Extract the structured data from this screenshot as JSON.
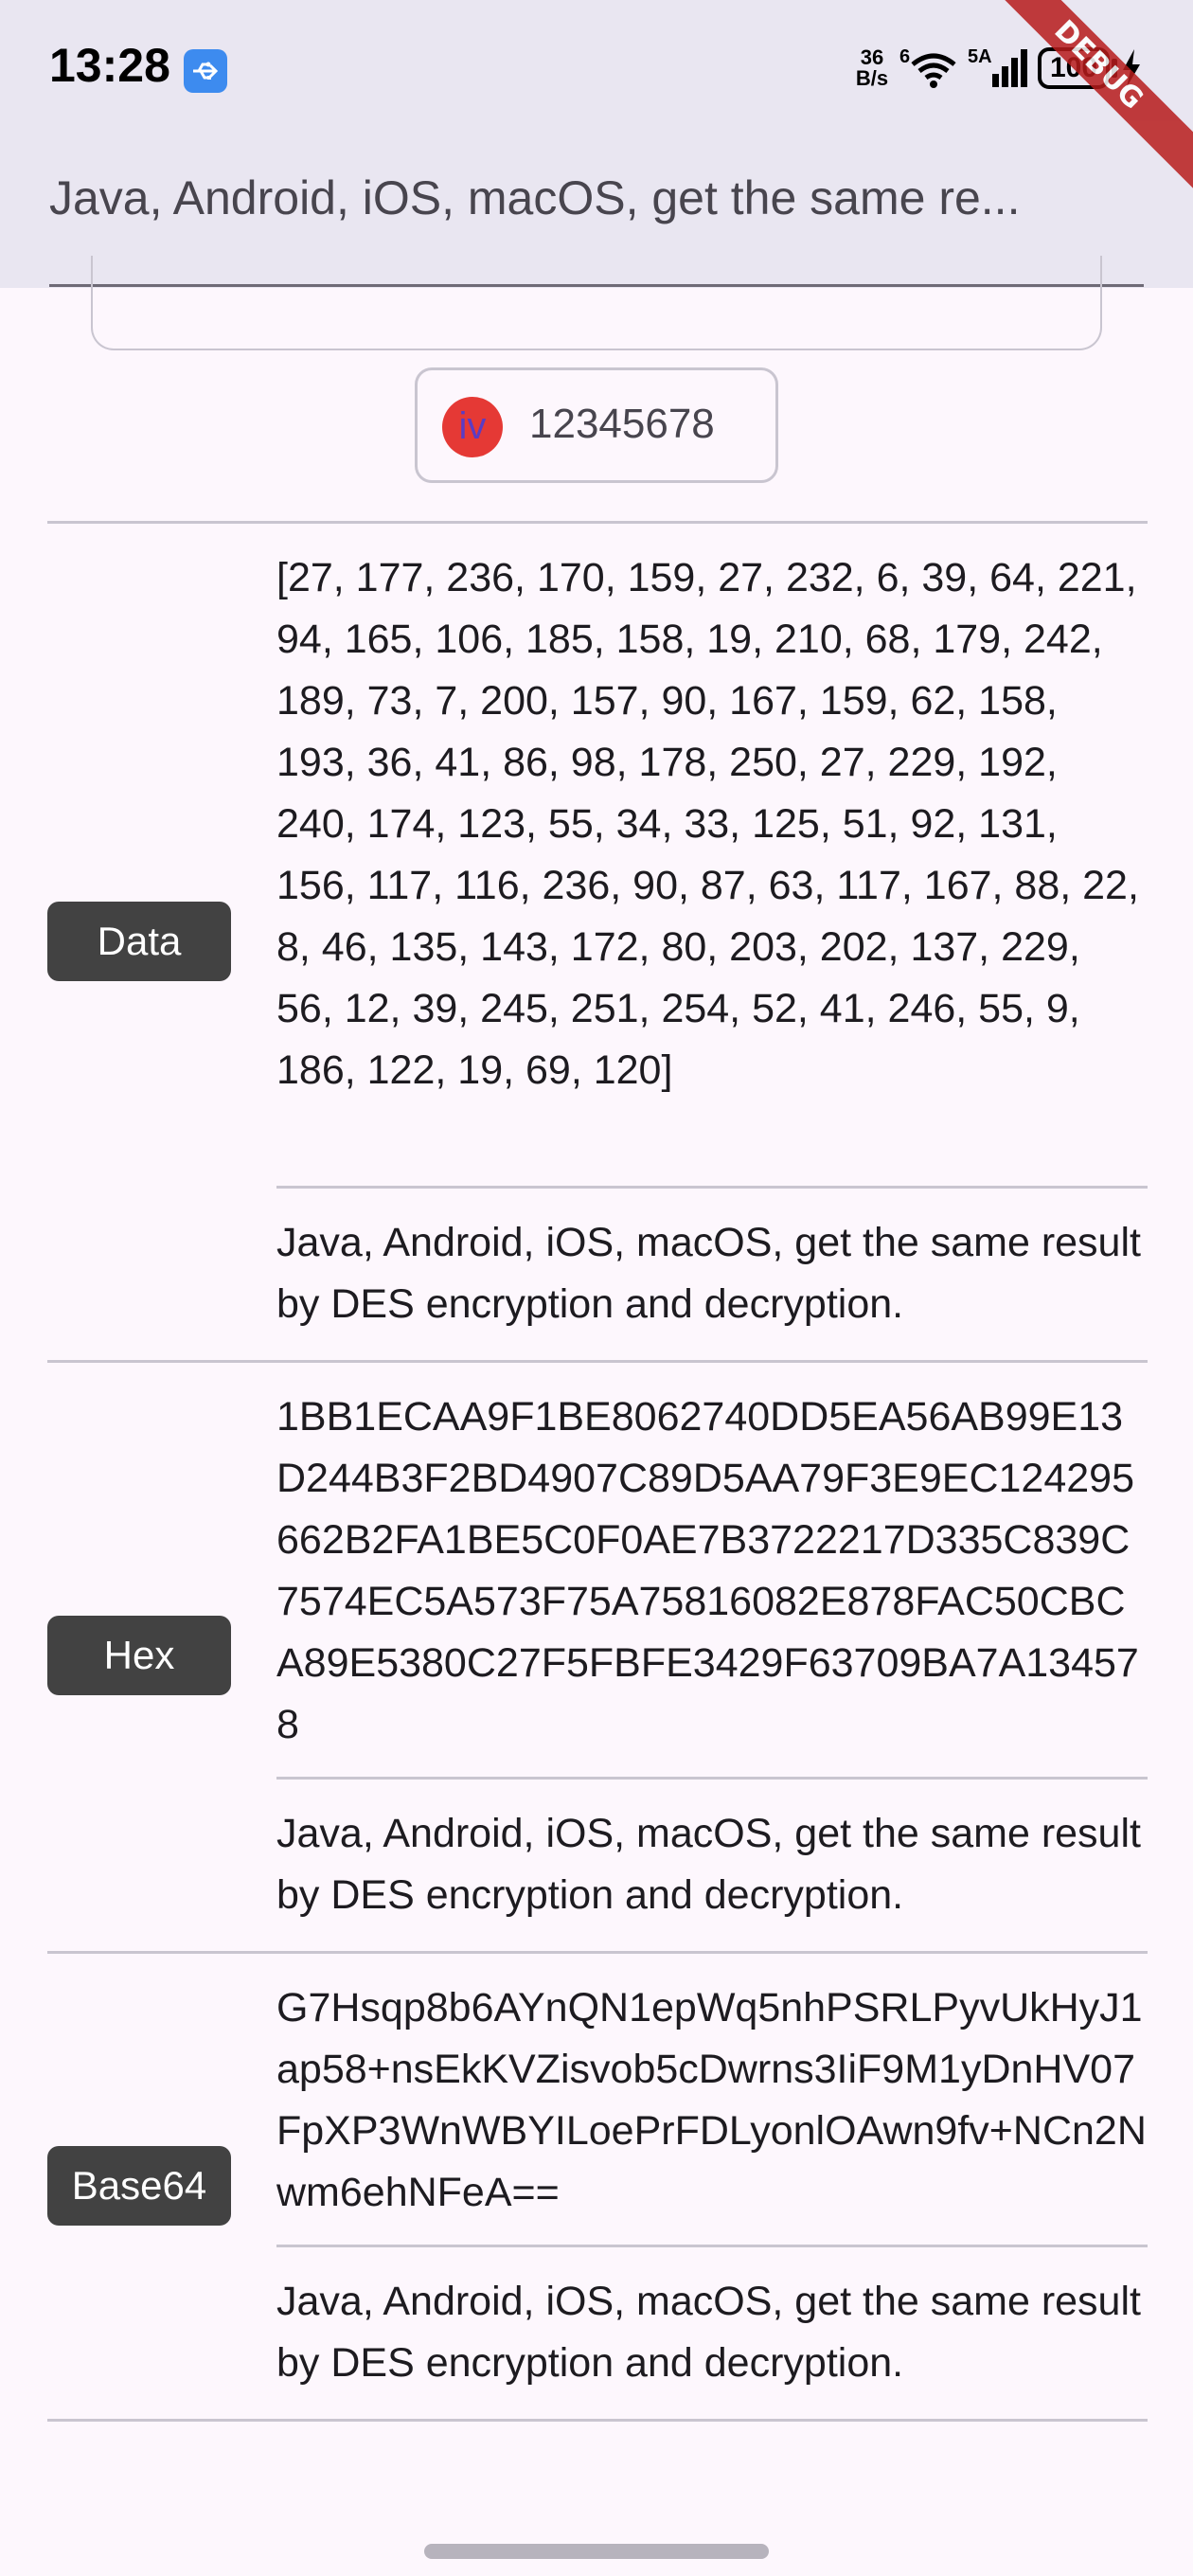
{
  "status_bar": {
    "time": "13:28",
    "net_speed_top": "36",
    "net_speed_bottom": "B/s",
    "wifi_sup": "6",
    "network_type": "5A",
    "battery": "100"
  },
  "debug_banner": "DEBUG",
  "appbar": {
    "title": "Java, Android, iOS, macOS, get the same re..."
  },
  "iv": {
    "avatar_label": "iv",
    "value": "12345678"
  },
  "rows": [
    {
      "label": "Data",
      "encrypted": "[27, 177, 236, 170, 159, 27, 232, 6, 39, 64, 221, 94, 165, 106, 185, 158, 19, 210, 68, 179, 242, 189, 73, 7, 200, 157, 90, 167, 159, 62, 158, 193, 36, 41, 86, 98, 178, 250, 27, 229, 192, 240, 174, 123, 55, 34, 33, 125, 51, 92, 131, 156, 117, 116, 236, 90, 87, 63, 117, 167, 88, 22, 8, 46, 135, 143, 172, 80, 203, 202, 137, 229, 56, 12, 39, 245, 251, 254, 52, 41, 246, 55, 9, 186, 122, 19, 69, 120]",
      "decrypted": "Java, Android, iOS, macOS, get the same result by DES encryption and decryption."
    },
    {
      "label": "Hex",
      "encrypted": "1BB1ECAA9F1BE8062740DD5EA56AB99E13D244B3F2BD4907C89D5AA79F3E9EC124295662B2FA1BE5C0F0AE7B3722217D335C839C7574EC5A573F75A75816082E878FAC50CBCA89E5380C27F5FBFE3429F63709BA7A134578",
      "decrypted": "Java, Android, iOS, macOS, get the same result by DES encryption and decryption."
    },
    {
      "label": "Base64",
      "encrypted": "G7Hsqp8b6AYnQN1epWq5nhPSRLPyvUkHyJ1ap58+nsEkKVZisvob5cDwrns3IiF9M1yDnHV07FpXP3WnWBYILoePrFDLyonlOAwn9fv+NCn2Nwm6ehNFeA==",
      "decrypted": "Java, Android, iOS, macOS, get the same result by DES encryption and decryption."
    }
  ],
  "colors": {
    "background": "#fdf7fd",
    "appbar": "#e9e6f1",
    "label_chip": "#424242",
    "avatar": "#e53935",
    "debug_banner": "#b71c1c"
  },
  "icons": [
    "usb-icon",
    "wifi-icon",
    "signal-icon",
    "battery-icon",
    "charging-bolt-icon"
  ]
}
